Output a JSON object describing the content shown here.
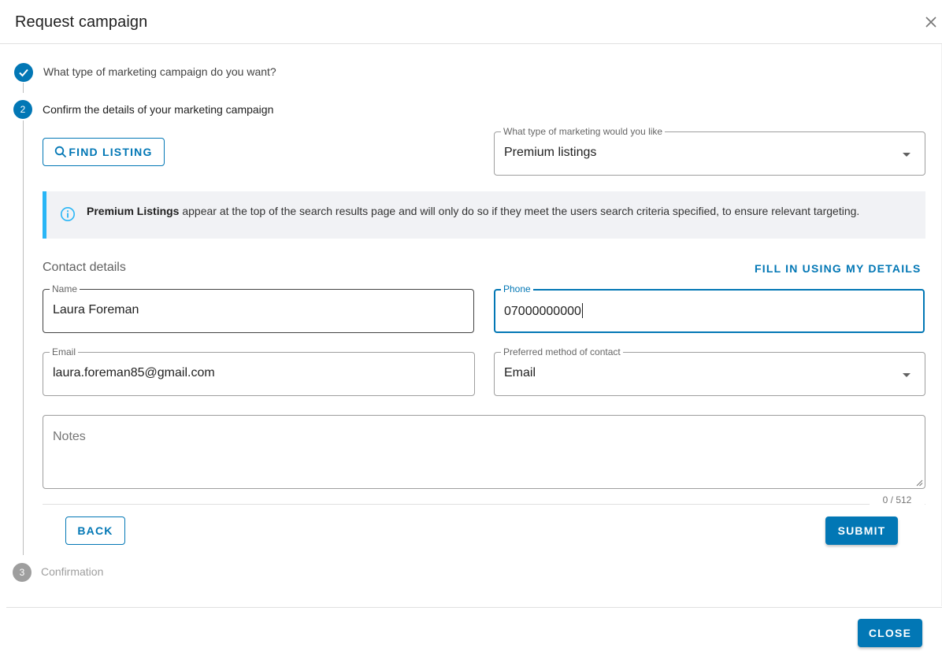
{
  "dialog": {
    "title": "Request campaign"
  },
  "stepper": {
    "steps": [
      {
        "number": "1",
        "label": "What type of marketing campaign do you want?",
        "state": "completed"
      },
      {
        "number": "2",
        "label": "Confirm the details of your marketing campaign",
        "state": "active"
      },
      {
        "number": "3",
        "label": "Confirmation",
        "state": "pending"
      }
    ]
  },
  "find_listing": {
    "label": "FIND LISTING",
    "icon": "search-icon"
  },
  "marketing_type": {
    "label": "What type of marketing would you like",
    "value": "Premium listings"
  },
  "info": {
    "icon": "info-icon",
    "bold": "Premium Listings",
    "text": " appear at the top of the search results page and will only do so if they meet the users search criteria specified, to ensure relevant targeting."
  },
  "contact": {
    "title": "Contact details",
    "fill_link": "FILL IN USING MY DETAILS",
    "name": {
      "label": "Name",
      "value": "Laura Foreman"
    },
    "phone": {
      "label": "Phone",
      "value": "07000000000"
    },
    "email": {
      "label": "Email",
      "value": "laura.foreman85@gmail.com"
    },
    "preferred": {
      "label": "Preferred method of contact",
      "value": "Email"
    },
    "notes": {
      "placeholder": "Notes",
      "counter": "0 / 512"
    }
  },
  "actions": {
    "back": "BACK",
    "submit": "SUBMIT"
  },
  "footer": {
    "close": "CLOSE"
  },
  "colors": {
    "primary": "#0277b5",
    "info_accent": "#29b6f6",
    "info_bg": "#f1f2f5",
    "pending_step": "#9e9e9e"
  }
}
